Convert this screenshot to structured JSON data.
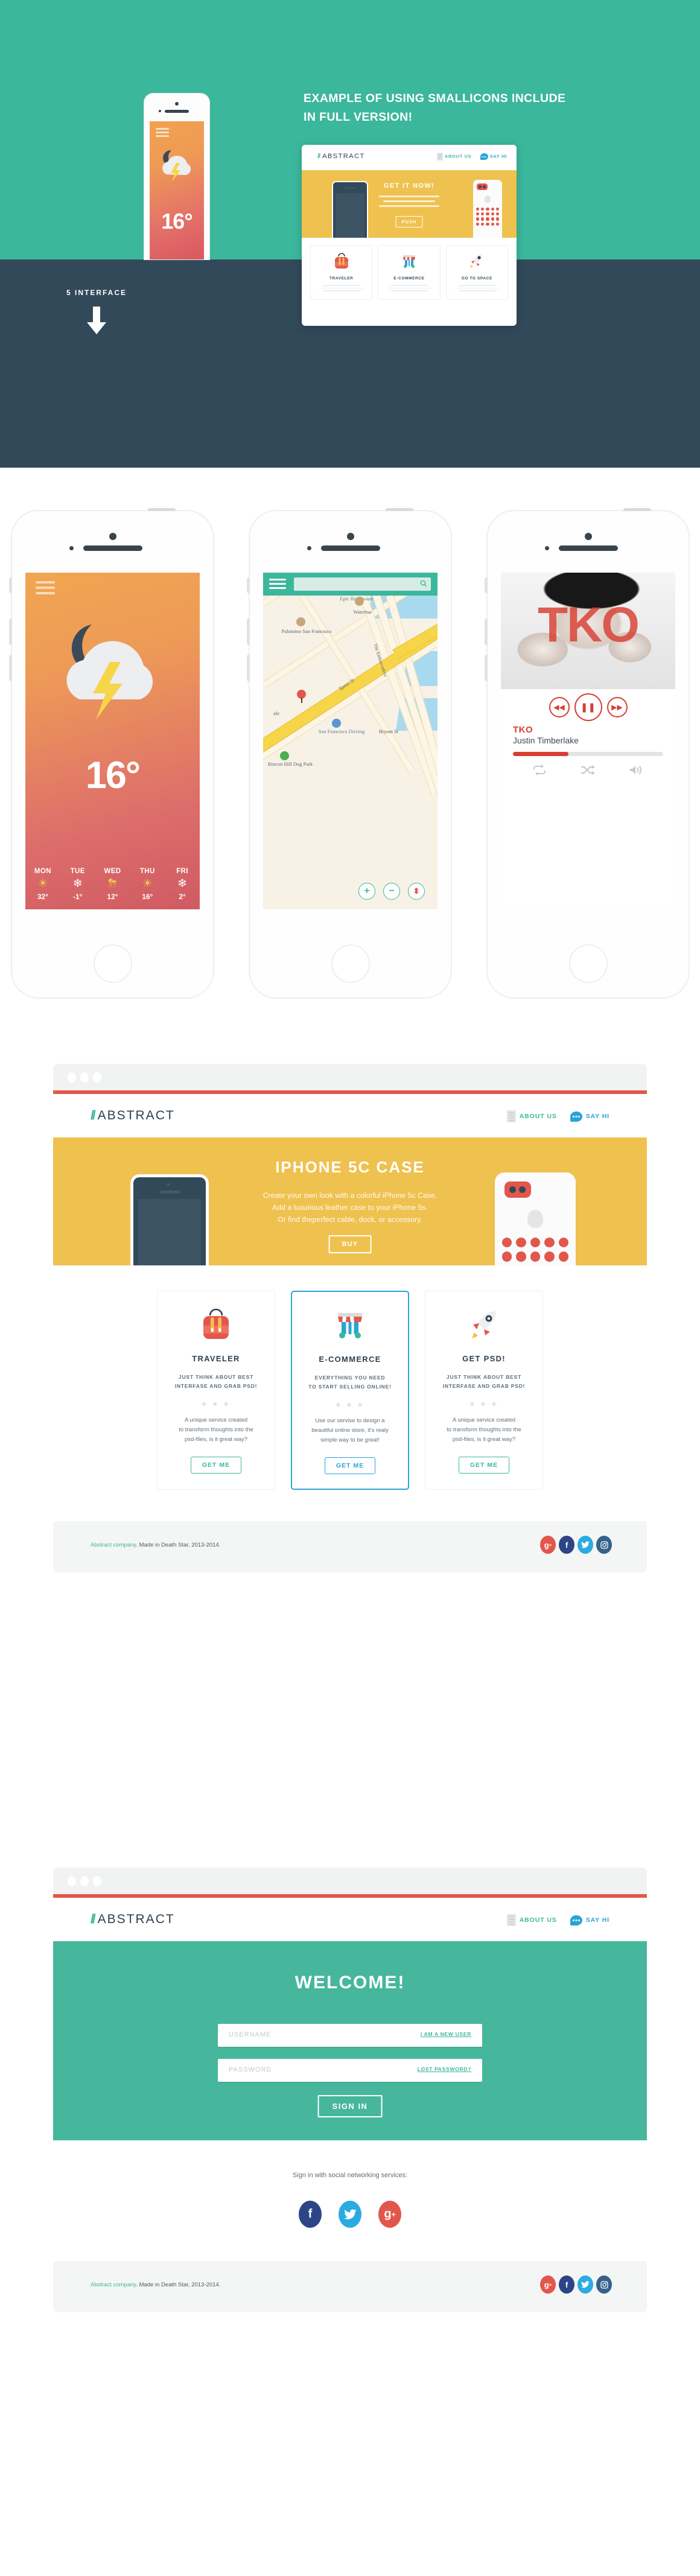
{
  "hero": {
    "headline": "EXAMPLE OF USING SMALLICONS INCLUDE IN FULL VERSION!",
    "subtitle": "5 INTERFACE",
    "phone_temp": "16°",
    "mini": {
      "logo_slashes": "//",
      "logo_text": "ABSTRACT",
      "nav": [
        {
          "label": "ABOUT US",
          "icon": "document-icon",
          "color": "#3bb79c"
        },
        {
          "label": "SAY HI",
          "icon": "chat-bubble-icon",
          "color": "#2aa3d5"
        }
      ],
      "banner_title": "GET IT NOW!",
      "banner_button": "PUSH",
      "cards": [
        {
          "label": "TRAVELER",
          "icon": "backpack-icon"
        },
        {
          "label": "E-COMMERCE",
          "icon": "shop-icon"
        },
        {
          "label": "GO TO SPACE",
          "icon": "rocket-icon"
        }
      ]
    }
  },
  "phones": {
    "weather": {
      "temperature": "16°",
      "icon": "moon-cloud-lightning-icon",
      "forecast": [
        {
          "day": "MON",
          "icon": "sun-icon",
          "glyph": "☀",
          "temp": "32°"
        },
        {
          "day": "TUE",
          "icon": "snow-icon",
          "glyph": "❄",
          "temp": "-1°"
        },
        {
          "day": "WED",
          "icon": "cloud-lightning-icon",
          "glyph": "⛈",
          "temp": "12°"
        },
        {
          "day": "THU",
          "icon": "sun-icon",
          "glyph": "☀",
          "temp": "16°"
        },
        {
          "day": "FRI",
          "icon": "snow-icon",
          "glyph": "❄",
          "temp": "2°"
        }
      ]
    },
    "map": {
      "search_placeholder": "",
      "labels": [
        "Epic Roadhouse",
        "Waterbar",
        "Palomino San Francisco",
        "The Embarcadero",
        "Spear St",
        "Bryant St",
        "San Francisco Driving",
        "Rincon Hill Dog Park",
        "afe"
      ],
      "controls": [
        "zoom-in",
        "zoom-out",
        "compass"
      ]
    },
    "music": {
      "cover_text": "TKO",
      "title": "TKO",
      "artist": "Justin Timberlake",
      "progress_percent": 37,
      "controls": [
        "rewind",
        "pause",
        "forward"
      ],
      "tools": [
        "repeat",
        "shuffle",
        "volume"
      ]
    }
  },
  "site": {
    "brand_slashes": "//",
    "brand_text": "ABSTRACT",
    "nav": [
      {
        "label": "ABOUT US",
        "icon": "document-icon"
      },
      {
        "label": "SAY HI",
        "icon": "chat-bubble-icon"
      }
    ],
    "banner": {
      "title": "IPHONE 5C CASE",
      "line1": "Create your own look with a colorful iPhone 5c Case.",
      "line2": "Add a luxurious leather case to your iPhone 5s.",
      "line3": "Or find theperfect cable, dock, or accessory.",
      "button": "BUY"
    },
    "cards": [
      {
        "icon": "backpack-icon",
        "title": "TRAVELER",
        "subtitle_line1": "JUST THINK ABOUT BEST",
        "subtitle_line2": "INTERFASE AND GRAB PSD!",
        "stars": "✳ ✳ ✳",
        "body_line1": "A unique service created",
        "body_line2": "to transform thoughts into the",
        "body_line3": "psd-files, is it great way?",
        "button": "GET ME",
        "active": false
      },
      {
        "icon": "shop-icon",
        "title": "E-COMMERCE",
        "subtitle_line1": "EVERYTHING YOU NEED",
        "subtitle_line2": "TO START SELLING ONLINE!",
        "stars": "✳ ✳ ✳",
        "body_line1": "Use our servise to design a",
        "body_line2": "beautiful online store, it's realy",
        "body_line3": "simple way to be great!",
        "button": "GET ME",
        "active": true
      },
      {
        "icon": "rocket-icon",
        "title": "GET PSD!",
        "subtitle_line1": "JUST THINK ABOUT BEST",
        "subtitle_line2": "INTERFASE AND GRAB PSD!",
        "stars": "✳ ✳ ✳",
        "body_line1": "A unique service created",
        "body_line2": "to transform thoughts into the",
        "body_line3": "psd-files, is it great way?",
        "button": "GET ME",
        "active": false
      }
    ],
    "footer": {
      "company": "Abstract company",
      "copyright": ". Made in Death Star, 2013-2014.",
      "socials": [
        "google-plus-icon",
        "facebook-icon",
        "twitter-icon",
        "instagram-icon"
      ]
    },
    "login": {
      "welcome": "WELCOME!",
      "username_placeholder": "USERNAME",
      "username_action": "I AM A NEW USER",
      "password_placeholder": "PASSWORD",
      "password_action": "LOST PASSWORD?",
      "signin_button": "SIGN IN",
      "social_caption": "Sign in with social networking services:",
      "social_buttons": [
        "facebook-icon",
        "twitter-icon",
        "google-plus-icon"
      ]
    }
  },
  "colors": {
    "teal": "#3bb79c",
    "navy": "#32495a",
    "yellow": "#efc14f",
    "red": "#e2574c",
    "blue": "#2aa3d5"
  }
}
